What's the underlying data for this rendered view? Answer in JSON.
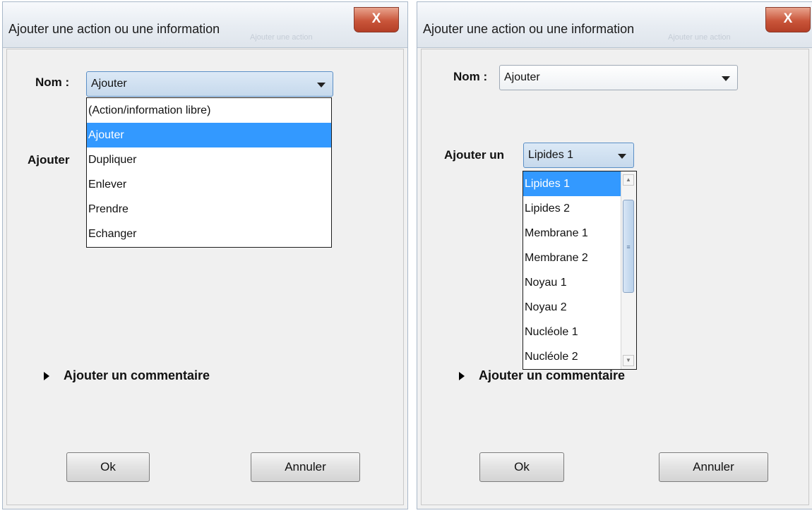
{
  "left_dialog": {
    "title": "Ajouter une action ou une information",
    "ghost_text": "Ajouter une action",
    "close_label": "X",
    "name_label": "Nom :",
    "name_value": "Ajouter",
    "add_label_partial": "Ajouter",
    "dropdown_options": [
      "(Action/information libre)",
      "Ajouter",
      "Dupliquer",
      "Enlever",
      "Prendre",
      "Echanger"
    ],
    "comment_label": "Ajouter un commentaire",
    "ok_label": "Ok",
    "cancel_label": "Annuler"
  },
  "right_dialog": {
    "title": "Ajouter une action ou une information",
    "ghost_text": "Ajouter une action",
    "close_label": "X",
    "name_label": "Nom :",
    "name_value": "Ajouter",
    "add_label": "Ajouter un",
    "add_value": "Lipides 1",
    "dropdown_options": [
      "Lipides 1",
      "Lipides 2",
      "Membrane 1",
      "Membrane 2",
      "Noyau 1",
      "Noyau 2",
      "Nucléole 1",
      "Nucléole 2"
    ],
    "comment_label": "Ajouter un commentaire",
    "ok_label": "Ok",
    "cancel_label": "Annuler"
  },
  "icons": {
    "expand": "triangle-right-icon",
    "dropdown_arrow": "chevron-down-icon",
    "close": "close-icon"
  }
}
